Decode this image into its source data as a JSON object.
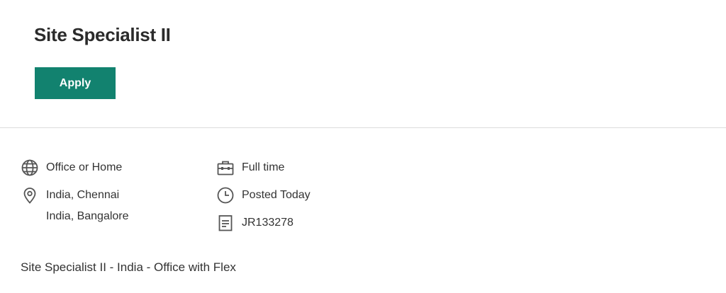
{
  "job": {
    "title": "Site Specialist II",
    "apply_label": "Apply"
  },
  "details": {
    "work_mode": "Office or Home",
    "locations": [
      "India, Chennai",
      "India, Bangalore"
    ],
    "employment_type": "Full time",
    "posted": "Posted Today",
    "job_id": "JR133278"
  },
  "footer": {
    "subtitle": "Site Specialist II - India - Office with Flex"
  },
  "icons": {
    "work_mode": "globe-icon",
    "location": "location-pin-icon",
    "employment_type": "briefcase-icon",
    "posted": "clock-icon",
    "job_id": "document-icon"
  },
  "colors": {
    "accent": "#12826f",
    "icon": "#555555",
    "divider": "#dcdcdc"
  }
}
